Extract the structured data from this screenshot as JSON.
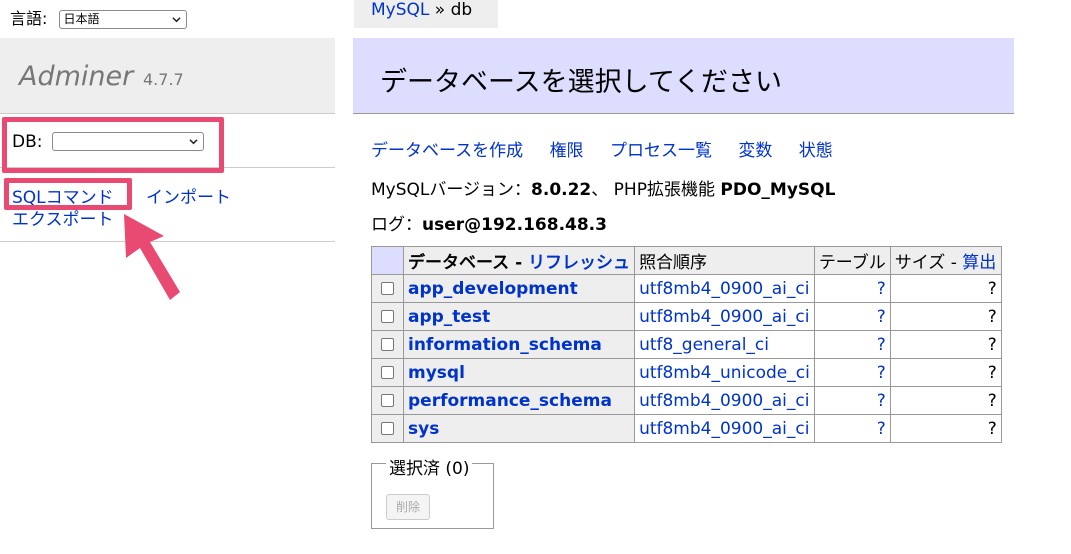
{
  "language": {
    "label": "言語:",
    "selected": "日本語"
  },
  "logo": {
    "name": "Adminer",
    "version": "4.7.7"
  },
  "db_selector": {
    "label": "DB:",
    "selected": ""
  },
  "sidebar_links": {
    "sql": "SQLコマンド",
    "import": "インポート",
    "export": "エクスポート"
  },
  "breadcrumb": {
    "root": "MySQL",
    "sep": " » ",
    "current": "db"
  },
  "page_title": "データベースを選択してください",
  "actions": [
    "データベースを作成",
    "権限",
    "プロセス一覧",
    "変数",
    "状態"
  ],
  "version_info": {
    "mysql_label": "MySQLバージョン：",
    "mysql_version": "8.0.22",
    "sep": "、",
    "php_label": "PHP拡張機能",
    "php_ext": "PDO_MySQL"
  },
  "login": {
    "label": "ログ：",
    "user": "user@192.168.48.3"
  },
  "table": {
    "headers": {
      "database": "データベース",
      "dash": " - ",
      "refresh": "リフレッシュ",
      "collation": "照合順序",
      "tables": "テーブル",
      "size": "サイズ",
      "size_dash": " - ",
      "compute": "算出"
    },
    "rows": [
      {
        "name": "app_development",
        "collation": "utf8mb4_0900_ai_ci",
        "tables": "?",
        "size": "?"
      },
      {
        "name": "app_test",
        "collation": "utf8mb4_0900_ai_ci",
        "tables": "?",
        "size": "?"
      },
      {
        "name": "information_schema",
        "collation": "utf8_general_ci",
        "tables": "?",
        "size": "?"
      },
      {
        "name": "mysql",
        "collation": "utf8mb4_unicode_ci",
        "tables": "?",
        "size": "?"
      },
      {
        "name": "performance_schema",
        "collation": "utf8mb4_0900_ai_ci",
        "tables": "?",
        "size": "?"
      },
      {
        "name": "sys",
        "collation": "utf8mb4_0900_ai_ci",
        "tables": "?",
        "size": "?"
      }
    ]
  },
  "selected": {
    "legend": "選択済 (0)",
    "delete": "削除"
  },
  "colors": {
    "highlight": "#e84a72",
    "link": "#0033cc",
    "header_bg": "#ddf"
  },
  "icons": [
    "chevron-down-icon",
    "annotation-arrow-icon"
  ]
}
